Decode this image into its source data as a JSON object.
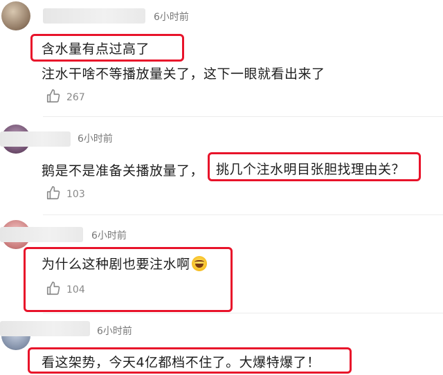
{
  "comments": [
    {
      "time": "6小时前",
      "line1": "含水量有点过高了",
      "line2": "注水干啥不等播放量关了，这下一眼就看出来了",
      "likes": "267"
    },
    {
      "time": "6小时前",
      "line1_plain": "鹅是不是准备关播放量了，",
      "line1_boxed": "挑几个注水明目张胆找理由关？",
      "likes": "103"
    },
    {
      "time": "6小时前",
      "line1": "为什么这种剧也要注水啊",
      "emoji": "laughing-tears-emoji",
      "likes": "104"
    },
    {
      "time": "6小时前",
      "line1": "看这架势，今天4亿都档不住了。大爆特爆了！"
    }
  ],
  "colors": {
    "highlight_border": "#e8132a",
    "meta_text": "#777777",
    "like_icon": "#888888"
  },
  "icons": {
    "like": "thumbs-up-icon"
  }
}
